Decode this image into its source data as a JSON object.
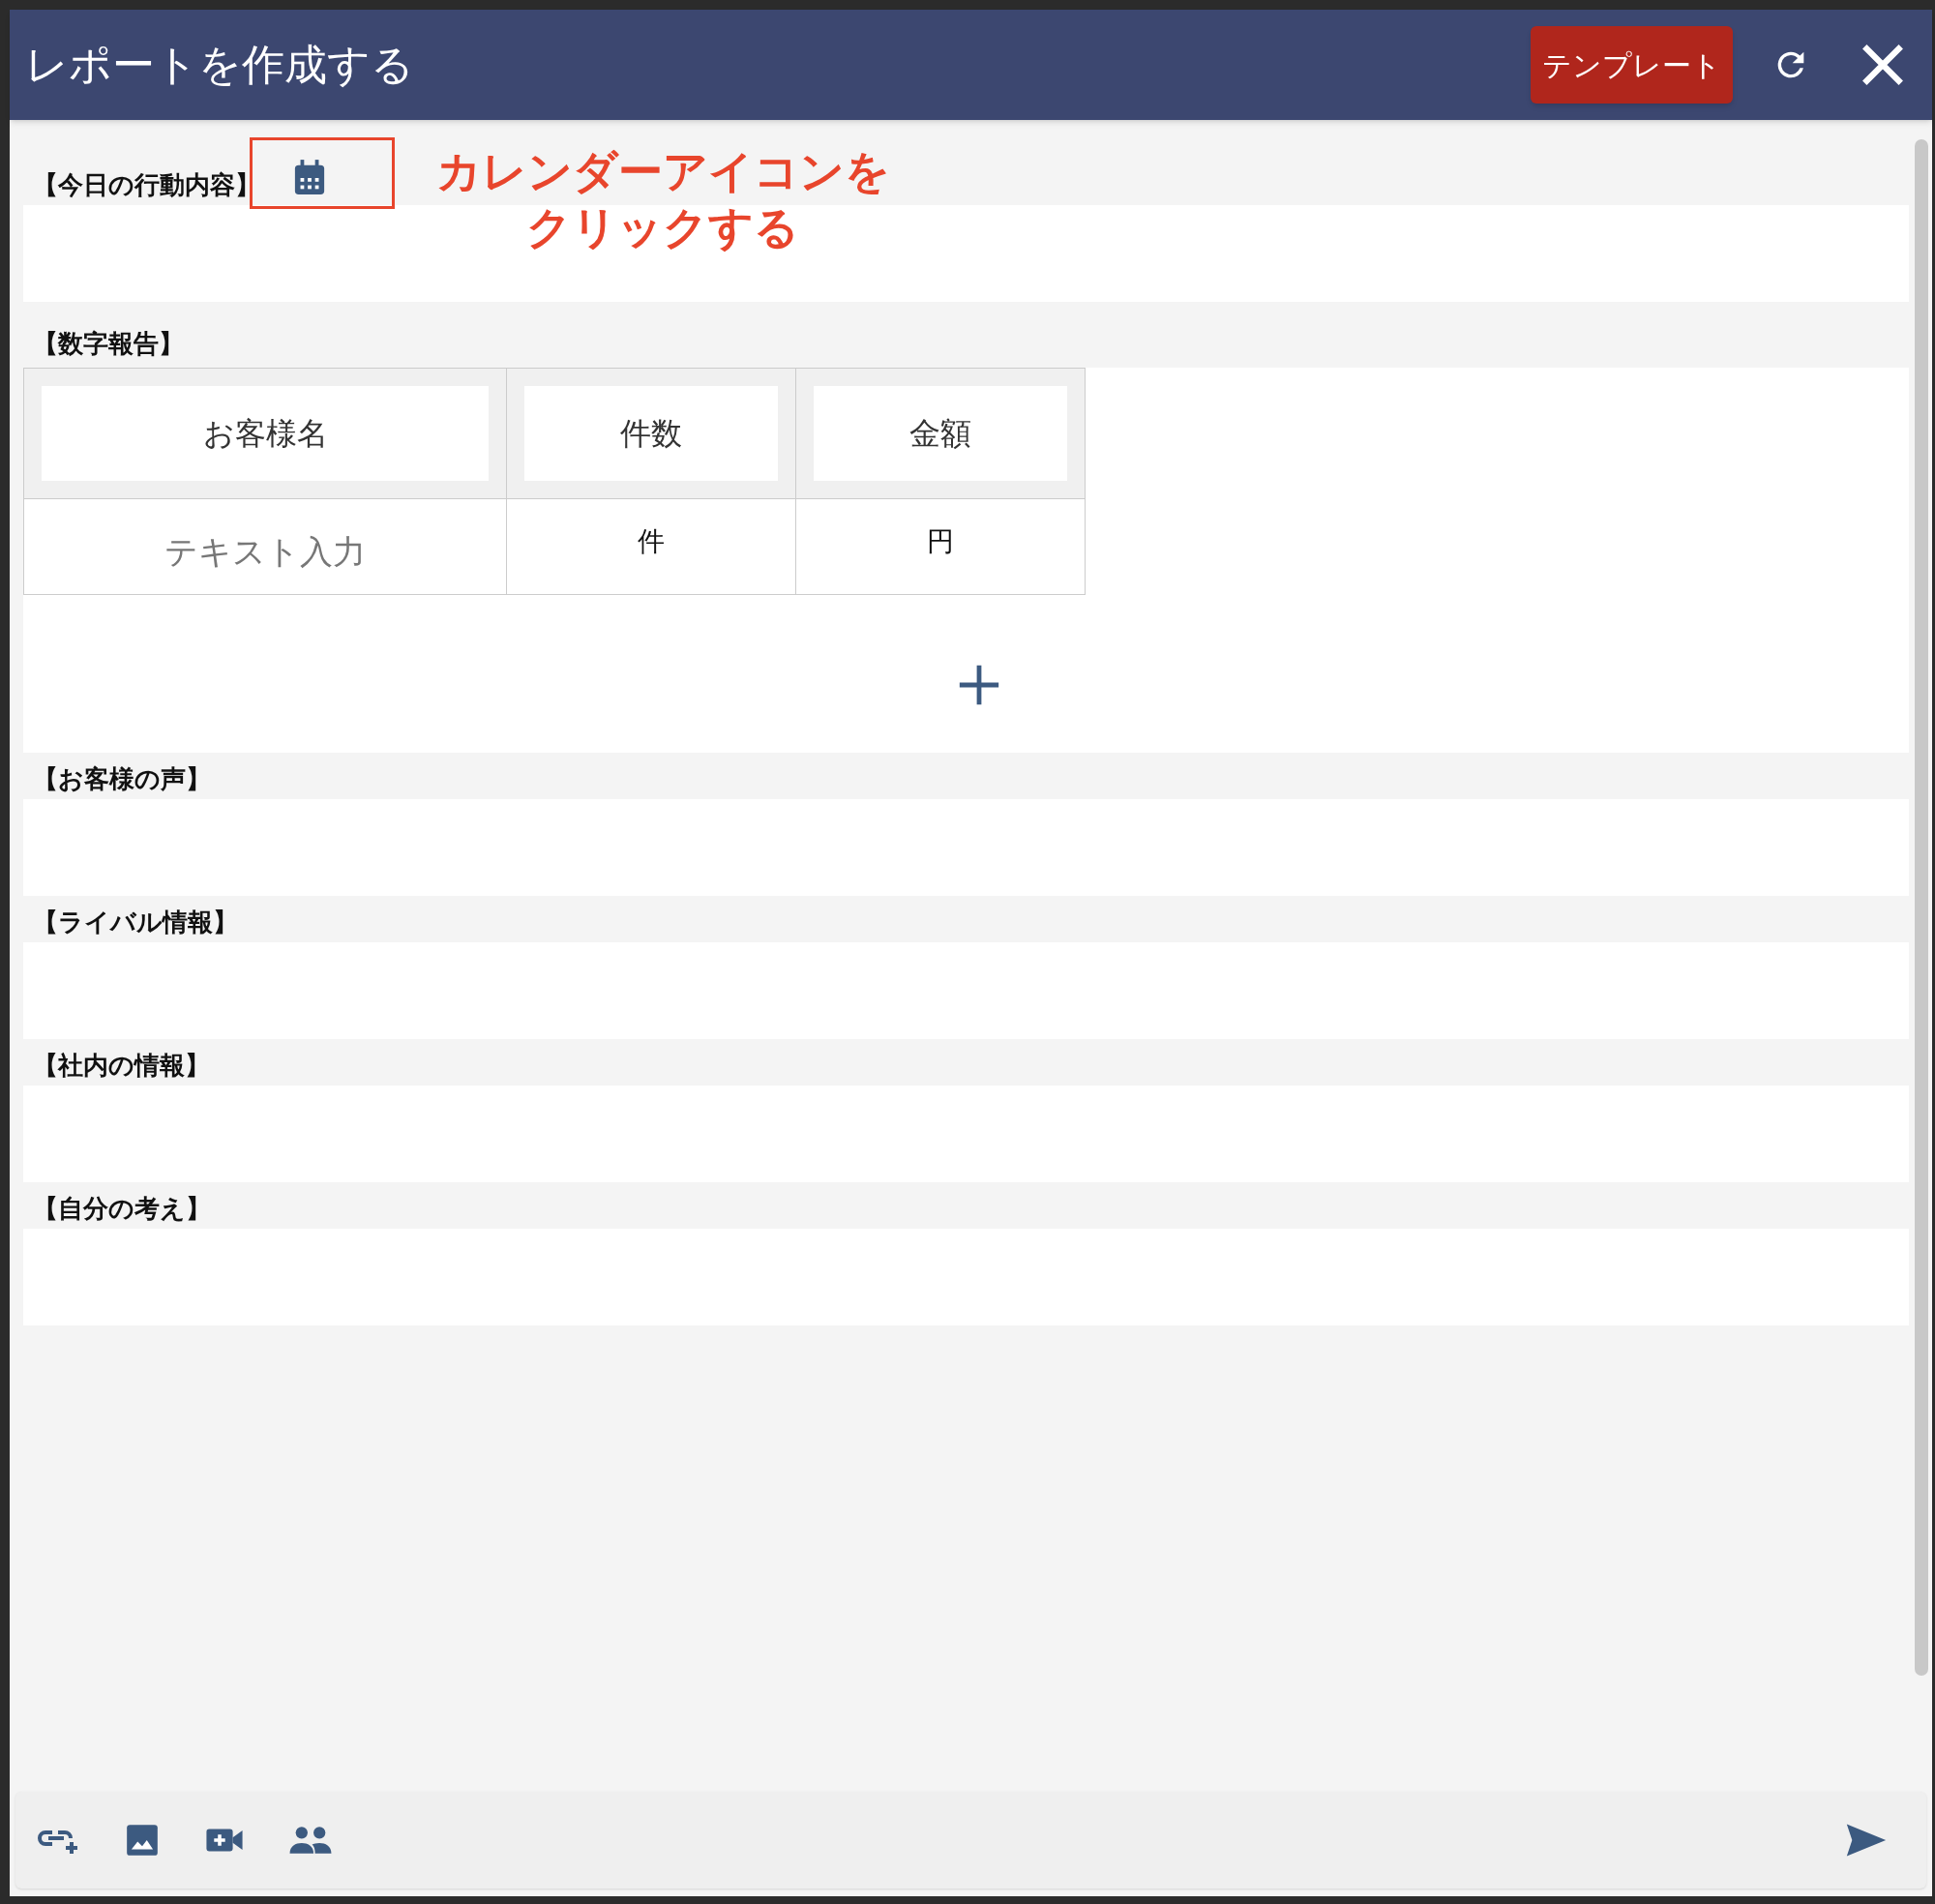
{
  "window": {
    "title": "レポートを作成する"
  },
  "header_buttons": {
    "template": "テンプレート"
  },
  "sections": [
    {
      "kind": "text",
      "label": "【今日の行動内容】",
      "calendar": true
    },
    {
      "kind": "table",
      "label": "【数字報告】",
      "calendar": false,
      "table": {
        "columns": [
          "お客様名",
          "件数",
          "金額"
        ],
        "rows": [
          [
            {
              "placeholder": "テキスト入力"
            },
            {
              "value": "件"
            },
            {
              "value": "円"
            }
          ]
        ]
      }
    },
    {
      "kind": "text",
      "label": "【お客様の声】",
      "calendar": false
    },
    {
      "kind": "text",
      "label": "【ライバル情報】",
      "calendar": false
    },
    {
      "kind": "text",
      "label": "【社内の情報】",
      "calendar": false
    },
    {
      "kind": "text",
      "label": "【自分の考え】",
      "calendar": false
    }
  ],
  "annotation": {
    "lines": [
      "カレンダーアイコンを",
      "クリックする"
    ]
  }
}
